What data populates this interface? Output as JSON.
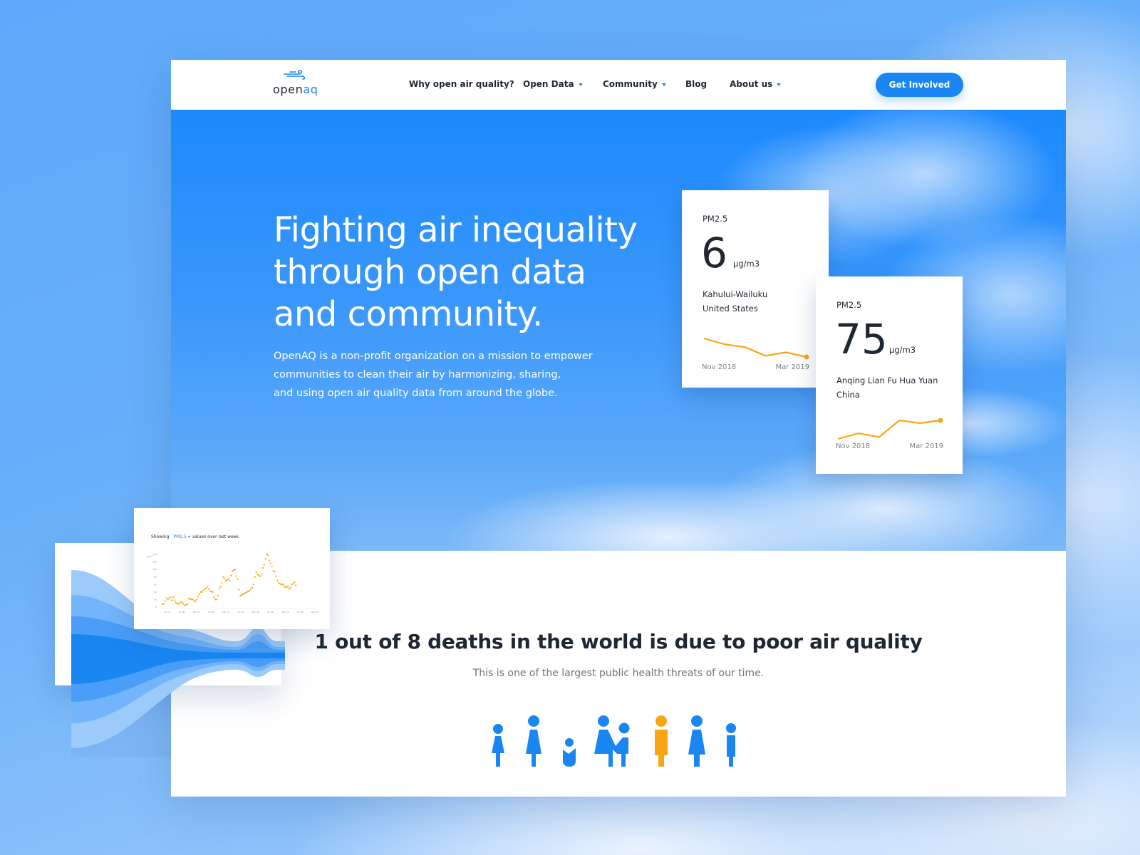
{
  "header": {
    "logo": {
      "text_main": "open",
      "text_accent": "aq",
      "icon": "wind-icon"
    },
    "nav": [
      {
        "label": "Why open air quality?",
        "dropdown": false
      },
      {
        "label": "Open Data",
        "dropdown": true
      },
      {
        "label": "Community",
        "dropdown": true
      },
      {
        "label": "Blog",
        "dropdown": false
      },
      {
        "label": "About us",
        "dropdown": true
      }
    ],
    "cta_label": "Get Involved"
  },
  "hero": {
    "title_lines": [
      "Fighting air inequality",
      "through open data",
      "and community."
    ],
    "text_lines": [
      "OpenAQ is a non-profit organization on a mission to empower",
      "communities to clean their air by harmonizing, sharing,",
      "and using open air quality data from around the globe."
    ]
  },
  "cards": [
    {
      "parameter": "PM2.5",
      "value": "6",
      "unit": "µg/m3",
      "location": "Kahului-Wailuku",
      "country": "United States",
      "x_start": "Nov 2018",
      "x_end": "Mar 2019",
      "trend": [
        8,
        7,
        6.5,
        5,
        5.6,
        4.8
      ]
    },
    {
      "parameter": "PM2.5",
      "value": "75",
      "unit": "µg/m3",
      "location": "Anqing Lian Fu Hua Yuan",
      "country": "China",
      "x_start": "Nov 2018",
      "x_end": "Mar 2019",
      "trend": [
        60,
        66,
        62,
        80,
        77,
        80
      ]
    }
  ],
  "weekly_chart": {
    "caption_prefix": "Showing",
    "selected_parameter": "PM2.5",
    "caption_suffix": "values over last week.",
    "y_unit": "µg/m³",
    "y_ticks": [
      "0",
      "20",
      "40",
      "60",
      "80",
      "100",
      "120",
      "140"
    ],
    "x_ticks": [
      "Fri 15",
      "12 PM",
      "Sat 16",
      "12 PM",
      "Mar 17",
      "12 PM",
      "Mon 18",
      "12 PM",
      "Tue 19",
      "12 PM",
      "Wed 20"
    ],
    "values": [
      8,
      8,
      16,
      24,
      20,
      22,
      26,
      18,
      26,
      18,
      12,
      10,
      8,
      10,
      14,
      12,
      8,
      4,
      6,
      8,
      22,
      22,
      20,
      20,
      16,
      16,
      20,
      28,
      34,
      40,
      40,
      44,
      48,
      50,
      54,
      48,
      42,
      42,
      40,
      26,
      20,
      20,
      30,
      50,
      54,
      64,
      80,
      76,
      70,
      72,
      74,
      70,
      84,
      96,
      98,
      100,
      82,
      74,
      46,
      30,
      32,
      34,
      36,
      38,
      40,
      42,
      44,
      48,
      52,
      60,
      80,
      92,
      86,
      84,
      82,
      88,
      104,
      112,
      128,
      140,
      138,
      124,
      116,
      108,
      96,
      94,
      82,
      70,
      64,
      62,
      60,
      60,
      56,
      52,
      54,
      54,
      48,
      52,
      60,
      62,
      66,
      58
    ],
    "ylim": [
      0,
      140
    ]
  },
  "stat": {
    "title": "1 out of 8 deaths in the world is due to poor air quality",
    "subtitle": "This is one of the largest public health threats of our time."
  },
  "people": [
    {
      "type": "woman-small",
      "color": "#1a86f2"
    },
    {
      "type": "woman",
      "color": "#1a86f2"
    },
    {
      "type": "baby",
      "color": "#1a86f2"
    },
    {
      "type": "woman-holding-child",
      "color": "#1a86f2"
    },
    {
      "type": "man",
      "color": "#faa614",
      "highlighted": true
    },
    {
      "type": "woman",
      "color": "#1a86f2"
    },
    {
      "type": "child",
      "color": "#1a86f2"
    }
  ],
  "colors": {
    "brand_blue": "#1a86f2",
    "accent_orange": "#faa614",
    "text_dark": "#1f2733"
  }
}
